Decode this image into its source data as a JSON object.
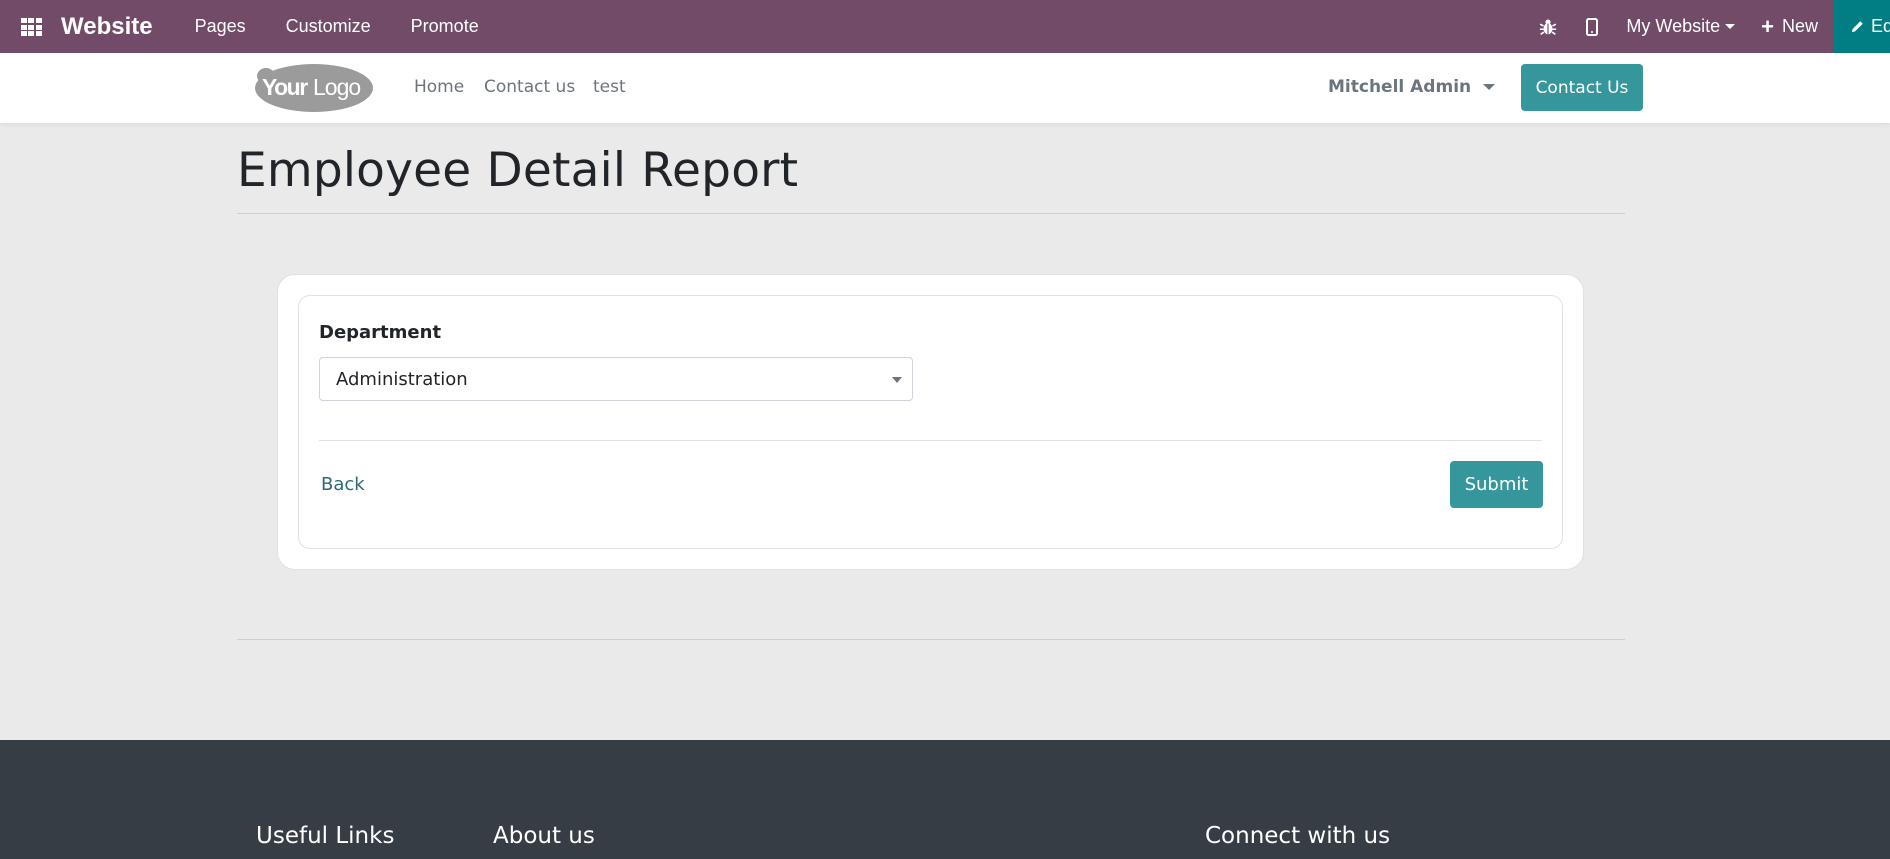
{
  "admin_bar": {
    "brand": "Website",
    "menu": [
      "Pages",
      "Customize",
      "Promote"
    ],
    "website_switcher": "My Website",
    "new_label": "New",
    "edit_label": "Ed",
    "bg_color": "#714b67",
    "edit_bg_color": "#017e84"
  },
  "site_header": {
    "logo_alt": "YourLogo",
    "logo_your": "Your",
    "logo_logo": "Logo",
    "nav": [
      "Home",
      "Contact us",
      "test"
    ],
    "user_name": "Mitchell Admin",
    "contact_button": "Contact Us",
    "accent_color": "#35979c"
  },
  "main": {
    "title": "Employee Detail Report",
    "form": {
      "department_label": "Department",
      "department_value": "Administration",
      "back_label": "Back",
      "submit_label": "Submit"
    }
  },
  "footer": {
    "headings": [
      "Useful Links",
      "About us",
      "Connect with us"
    ],
    "bg_color": "#373d45"
  }
}
